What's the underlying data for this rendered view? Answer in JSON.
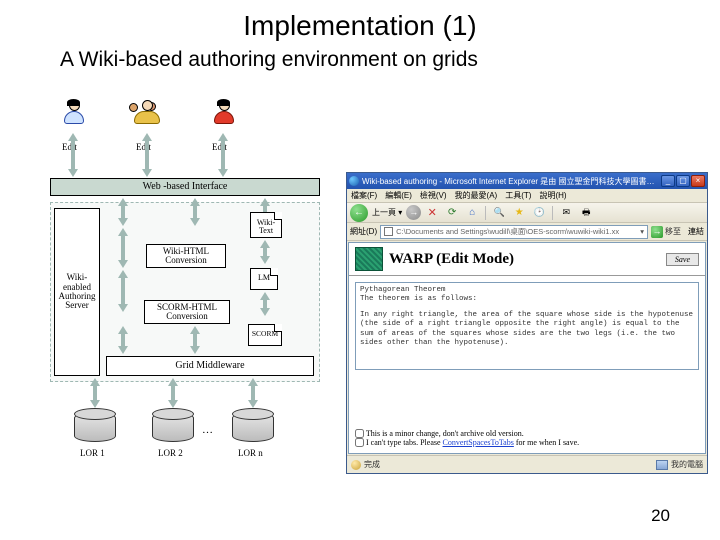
{
  "title": "Implementation (1)",
  "subtitle": "A Wiki-based authoring environment on grids",
  "page_number": "20",
  "diagram": {
    "edit_label": "Edit",
    "web_interface": "Web -based Interface",
    "wiki_server": "Wiki-enabled Authoring Server",
    "wiki_text": "Wiki-Text",
    "wiki_html": "Wiki-HTML Conversion",
    "lm": "LM",
    "scorm_html": "SCORM-HTML Conversion",
    "scorm": "SCORM",
    "grid_mw": "Grid Middleware",
    "lor1": "LOR 1",
    "lor2": "LOR 2",
    "lorn": "LOR n"
  },
  "browser": {
    "win_title": "Wiki-based authoring - Microsoft Internet Explorer 是由 國立聖金門科技大學圖書館 提供",
    "menu": {
      "file": "檔案(F)",
      "edit": "編輯(E)",
      "view": "檢視(V)",
      "fav": "我的最愛(A)",
      "tools": "工具(T)",
      "help": "說明(H)"
    },
    "addr_label": "網址(D)",
    "address": "C:\\Documents and Settings\\wudill\\桌面\\OES-scorm\\wuwiki-wiki1.xx",
    "go": "移至",
    "links": "連結",
    "warp_title": "WARP (Edit Mode)",
    "save": "Save",
    "edit_line1": "Pythagorean Theorem",
    "edit_line2": "The theorem is as follows:",
    "edit_body": "In any right triangle, the area of the square whose side is the hypotenuse (the side of a right triangle opposite the right angle) is equal to the sum of areas of the squares whose sides are the two legs (i.e. the two sides other than the hypotenuse).",
    "cb1": "This is a minor change, don't archive old version.",
    "cb2_a": "I can't type tabs. Please ",
    "cb2_link": "ConvertSpacesToTabs",
    "cb2_b": " for me when I save.",
    "status_done": "完成",
    "status_zone": "我的電腦"
  }
}
